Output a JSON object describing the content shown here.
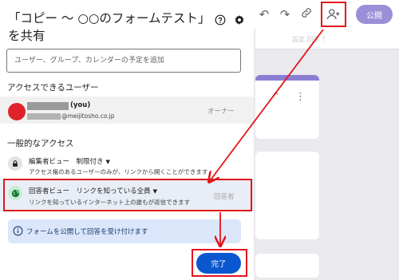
{
  "background": {
    "toolbar": {
      "publish_label": "公開"
    },
    "tab_hint": "設定 回答 ？"
  },
  "dialog": {
    "title": "「コピー ～ ○○のフォームテスト」を共有",
    "help_icon": "help-circle-icon",
    "settings_icon": "gear-icon",
    "search_placeholder": "ユーザー、グループ、カレンダーの予定を追加",
    "users_heading": "アクセスできるユーザー",
    "owner": {
      "you_label": "(you)",
      "email_domain": "@meijitosho.co.jp",
      "role": "オーナー",
      "avatar_color": "#e0232a"
    },
    "general_heading": "一般的なアクセス",
    "editor_access": {
      "title": "編集者ビュー　制限付き",
      "description": "アクセス権のあるユーザーのみが、リンクから開くことができます",
      "icon": "lock-icon"
    },
    "responder_access": {
      "title": "回答者ビュー　リンクを知っている全員",
      "description": "リンクを知っているインターネット上の誰もが返信できます",
      "role": "回答者",
      "icon": "globe-icon",
      "icon_color": "#137333"
    },
    "info_banner": {
      "text": "フォームを公開して回答を受け付けます",
      "icon": "info-icon"
    },
    "done_label": "完了",
    "accent": "#0b57d0"
  },
  "annotation_color": "#e3141b"
}
